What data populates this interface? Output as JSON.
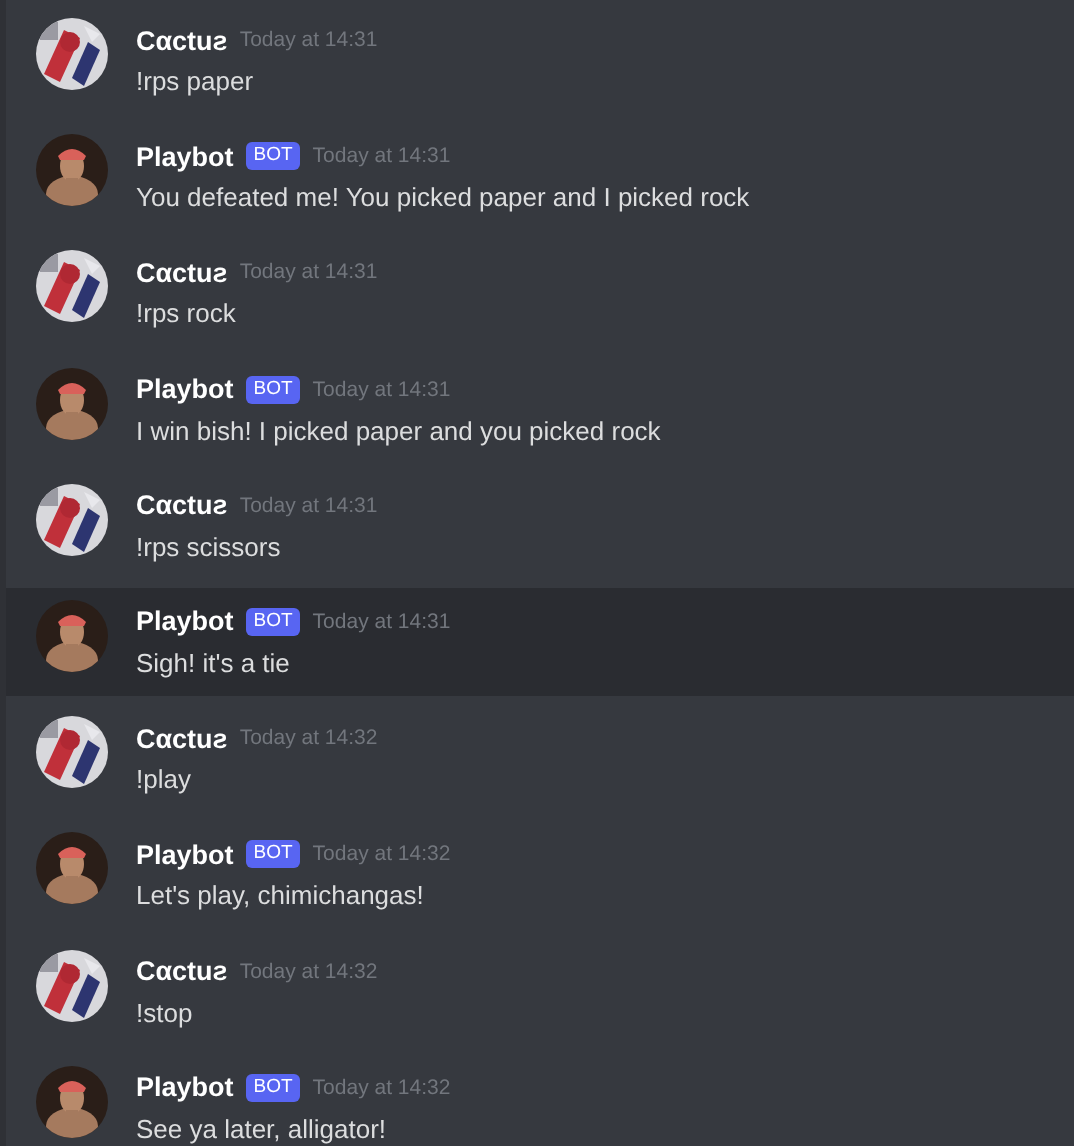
{
  "messages": [
    {
      "author": "Cαctuƨ",
      "kind": "user",
      "time": "Today at 14:31",
      "text": "!rps paper",
      "highlighted": false
    },
    {
      "author": "Playbot",
      "kind": "bot",
      "bot_tag": "BOT",
      "time": "Today at 14:31",
      "text": "You defeated me! You picked paper and I picked rock",
      "highlighted": false
    },
    {
      "author": "Cαctuƨ",
      "kind": "user",
      "time": "Today at 14:31",
      "text": "!rps rock",
      "highlighted": false
    },
    {
      "author": "Playbot",
      "kind": "bot",
      "bot_tag": "BOT",
      "time": "Today at 14:31",
      "text": "I win bish! I picked paper and you picked rock",
      "highlighted": false
    },
    {
      "author": "Cαctuƨ",
      "kind": "user",
      "time": "Today at 14:31",
      "text": "!rps scissors",
      "highlighted": false
    },
    {
      "author": "Playbot",
      "kind": "bot",
      "bot_tag": "BOT",
      "time": "Today at 14:31",
      "text": "Sigh! it's a tie",
      "highlighted": true
    },
    {
      "author": "Cαctuƨ",
      "kind": "user",
      "time": "Today at 14:32",
      "text": "!play",
      "highlighted": false
    },
    {
      "author": "Playbot",
      "kind": "bot",
      "bot_tag": "BOT",
      "time": "Today at 14:32",
      "text": "Let's play, chimichangas!",
      "highlighted": false
    },
    {
      "author": "Cαctuƨ",
      "kind": "user",
      "time": "Today at 14:32",
      "text": "!stop",
      "highlighted": false
    },
    {
      "author": "Playbot",
      "kind": "bot",
      "bot_tag": "BOT",
      "time": "Today at 14:32",
      "text": "See ya later, alligator!",
      "highlighted": false
    }
  ]
}
